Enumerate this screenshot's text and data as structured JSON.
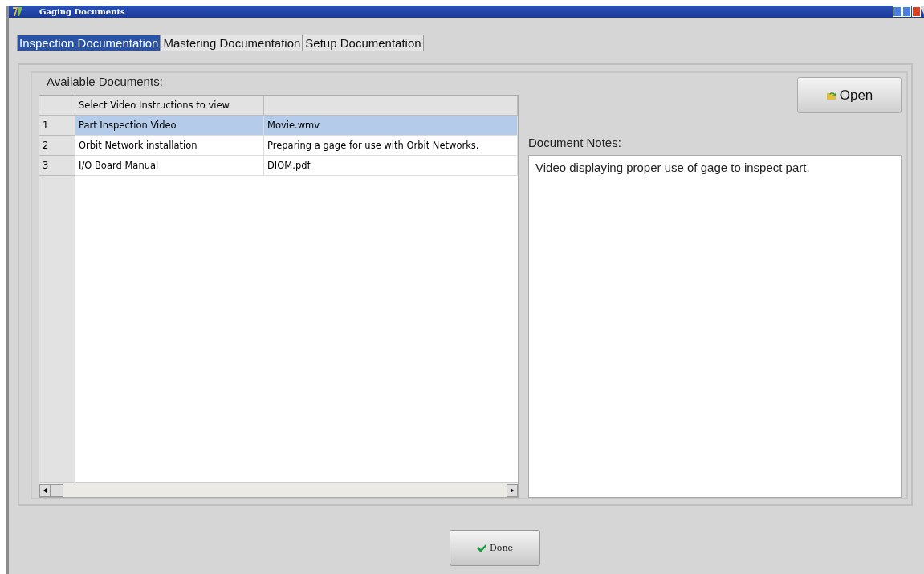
{
  "window": {
    "title": "Gaging Documents"
  },
  "tabs": [
    {
      "label": "Inspection Documentation",
      "selected": true
    },
    {
      "label": "Mastering Documentation",
      "selected": false
    },
    {
      "label": "Setup Documentation",
      "selected": false
    }
  ],
  "documents": {
    "label": "Available Documents:",
    "columns": [
      "Select Video Instructions to view"
    ],
    "rows": [
      {
        "number": "1",
        "name": "Part Inspection Video",
        "file": "Movie.wmv",
        "selected": true
      },
      {
        "number": "2",
        "name": "Orbit Network installation",
        "file": "Preparing a gage for use with Orbit Networks.",
        "selected": false
      },
      {
        "number": "3",
        "name": "I/O Board Manual",
        "file": "DIOM.pdf",
        "selected": false
      }
    ]
  },
  "open_button": {
    "label": "Open"
  },
  "notes": {
    "label": "Document Notes:",
    "text": "Video displaying proper use of gage to inspect part."
  },
  "done_button": {
    "label": "Done"
  }
}
